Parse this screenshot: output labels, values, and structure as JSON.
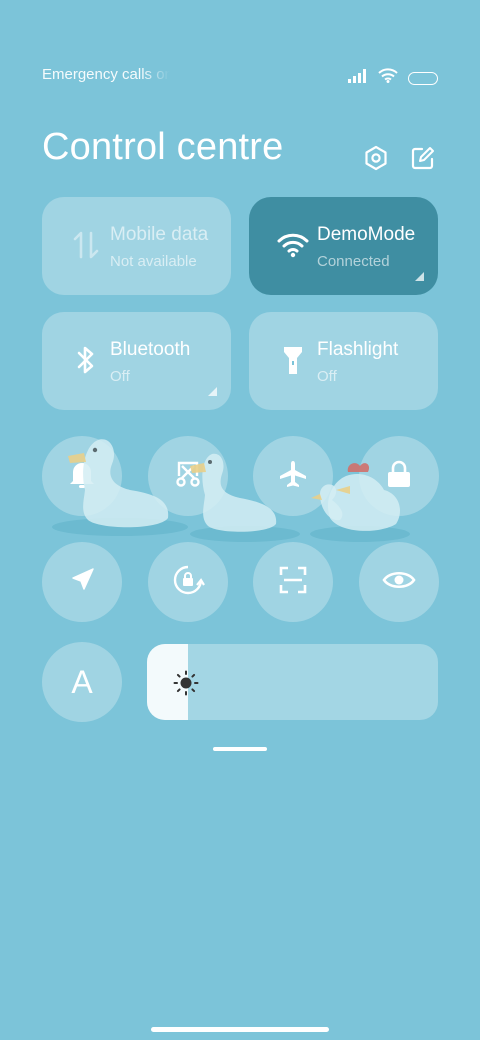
{
  "status_bar": {
    "carrier_text": "Emergency calls only",
    "icons": [
      "signal-icon",
      "wifi-icon",
      "battery-icon"
    ]
  },
  "header": {
    "title": "Control centre",
    "buttons": [
      "settings-icon",
      "edit-icon"
    ]
  },
  "tiles": [
    {
      "name": "mobile-data",
      "title": "Mobile data",
      "subtitle": "Not available",
      "state": "disabled",
      "icon": "data-arrows-icon"
    },
    {
      "name": "wifi",
      "title": "DemoMode",
      "subtitle": "Connected",
      "state": "active",
      "icon": "wifi-icon"
    },
    {
      "name": "bluetooth",
      "title": "Bluetooth",
      "subtitle": "Off",
      "state": "off",
      "icon": "bluetooth-icon"
    },
    {
      "name": "flashlight",
      "title": "Flashlight",
      "subtitle": "Off",
      "state": "off",
      "icon": "flashlight-icon"
    }
  ],
  "toggles_row1": [
    "bell-icon",
    "screenshot-icon",
    "airplane-icon",
    "lock-icon"
  ],
  "toggles_row2": [
    "location-icon",
    "rotation-lock-icon",
    "scanner-icon",
    "eye-icon"
  ],
  "font_toggle": {
    "label": "A"
  },
  "brightness": {
    "level": 0.14,
    "icon": "sun-icon"
  },
  "colors": {
    "background": "#7cc4d9",
    "tile": "rgba(255,255,255,0.28)",
    "tile_active": "#3f8ea2",
    "text": "#ffffff"
  }
}
